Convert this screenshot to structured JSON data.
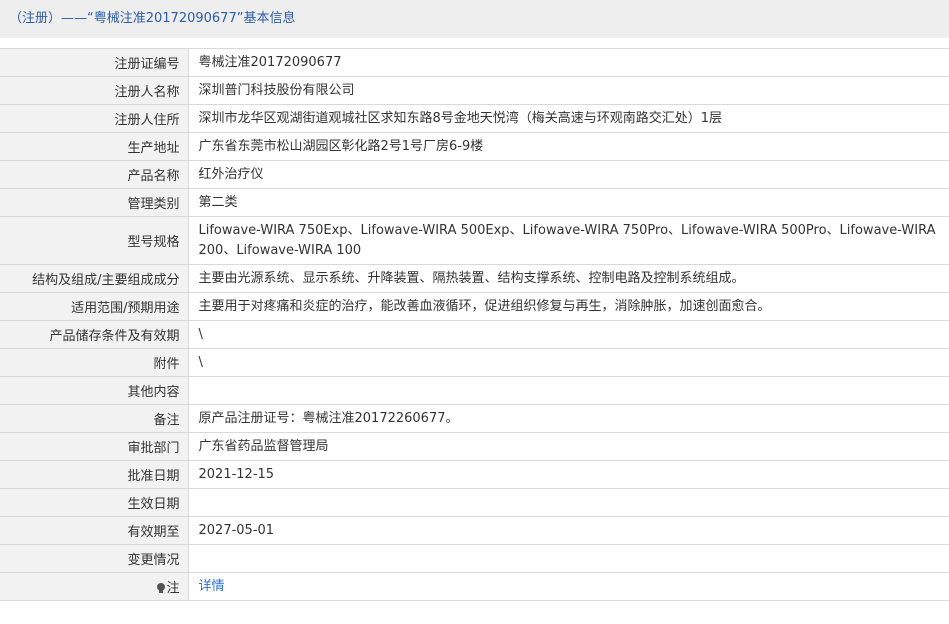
{
  "title": "（注册）——“粤械注准20172090677”基本信息",
  "rows": [
    {
      "label": "注册证编号",
      "value": "粤械注准20172090677"
    },
    {
      "label": "注册人名称",
      "value": "深圳普门科技股份有限公司"
    },
    {
      "label": "注册人住所",
      "value": "深圳市龙华区观湖街道观城社区求知东路8号金地天悦湾（梅关高速与环观南路交汇处）1层"
    },
    {
      "label": "生产地址",
      "value": "广东省东莞市松山湖园区彰化路2号1号厂房6-9楼"
    },
    {
      "label": "产品名称",
      "value": "红外治疗仪"
    },
    {
      "label": "管理类别",
      "value": "第二类"
    },
    {
      "label": "型号规格",
      "value": "Lifowave-WIRA 750Exp、Lifowave-WIRA 500Exp、Lifowave-WIRA 750Pro、Lifowave-WIRA 500Pro、Lifowave-WIRA 200、Lifowave-WIRA 100"
    },
    {
      "label": "结构及组成/主要组成成分",
      "value": "主要由光源系统、显示系统、升降装置、隔热装置、结构支撑系统、控制电路及控制系统组成。"
    },
    {
      "label": "适用范围/预期用途",
      "value": "主要用于对疼痛和炎症的治疗，能改善血液循环，促进组织修复与再生，消除肿胀，加速创面愈合。"
    },
    {
      "label": "产品储存条件及有效期",
      "value": "\\"
    },
    {
      "label": "附件",
      "value": "\\"
    },
    {
      "label": "其他内容",
      "value": ""
    },
    {
      "label": "备注",
      "value": "原产品注册证号：粤械注准20172260677。"
    },
    {
      "label": "审批部门",
      "value": "广东省药品监督管理局"
    },
    {
      "label": "批准日期",
      "value": "2021-12-15"
    },
    {
      "label": "生效日期",
      "value": ""
    },
    {
      "label": "有效期至",
      "value": "2027-05-01"
    },
    {
      "label": "变更情况",
      "value": ""
    }
  ],
  "note": {
    "label": "注",
    "icon": "lightbulb-icon",
    "link_text": "详情"
  }
}
